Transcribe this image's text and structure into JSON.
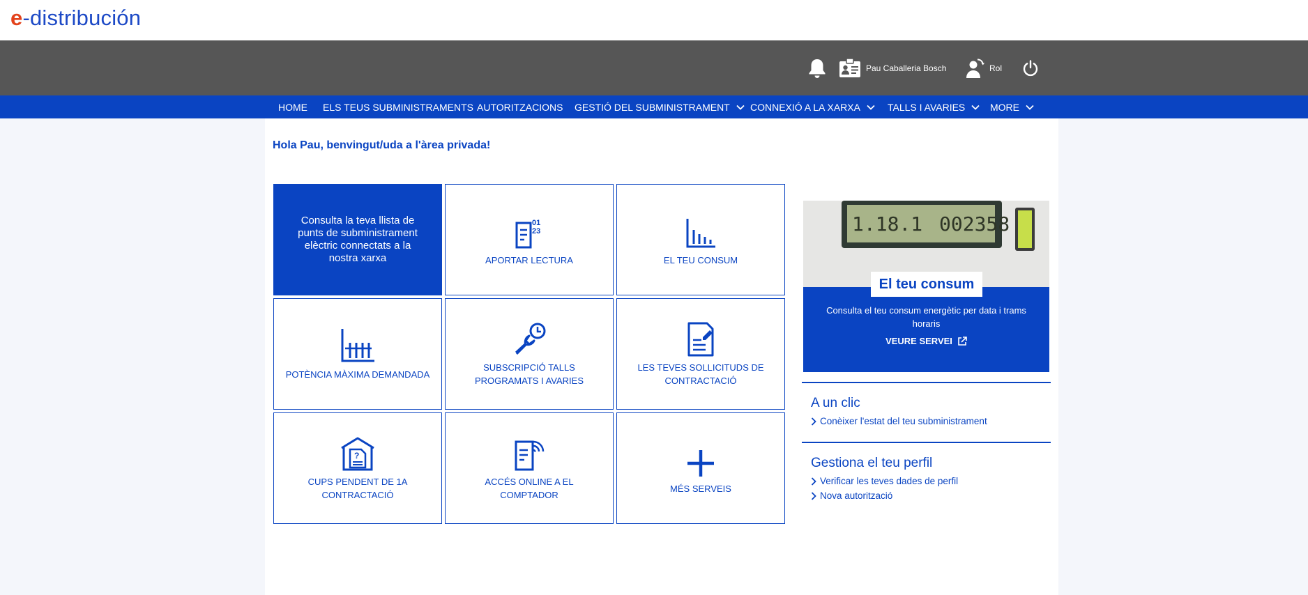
{
  "header": {
    "logo_e": "e",
    "logo_rest": "-distribución"
  },
  "topbar": {
    "user_name": "Pau Caballeria Bosch",
    "role_label": "Rol"
  },
  "nav": {
    "items": [
      {
        "label": "HOME"
      },
      {
        "label": "ELS TEUS SUBMINISTRAMENTS"
      },
      {
        "label": "AUTORITZACIONS"
      },
      {
        "label": "GESTIÓ DEL SUBMINISTRAMENT"
      },
      {
        "label": "CONNEXIÓ A LA XARXA"
      },
      {
        "label": "TALLS I AVARIES"
      },
      {
        "label": "MORE"
      }
    ]
  },
  "main": {
    "greeting": "Hola Pau, benvingut/uda a l'àrea privada!",
    "featured_tile": "Consulta la teva llista de punts de subministrament elèctric connectats a la nostra xarxa",
    "tiles": [
      {
        "label": "APORTAR LECTURA",
        "icon": "meter-reading-icon"
      },
      {
        "label": "EL TEU CONSUM",
        "icon": "consumption-chart-icon"
      },
      {
        "label": "POTÈNCIA MÀXIMA DEMANDADA",
        "icon": "max-power-chart-icon"
      },
      {
        "label": "SUBSCRIPCIÓ TALLS PROGRAMATS I AVARIES",
        "icon": "wrench-clock-icon"
      },
      {
        "label": "LES TEVES SOLLICITUDS DE CONTRACTACIÓ",
        "icon": "document-edit-icon"
      },
      {
        "label": "CUPS PENDENT DE 1A CONTRACTACIÓ",
        "icon": "house-question-icon"
      },
      {
        "label": "ACCÉS ONLINE A EL COMPTADOR",
        "icon": "online-meter-icon"
      },
      {
        "label": "MÉS SERVEIS",
        "icon": "plus-icon"
      }
    ]
  },
  "promo": {
    "meter_display_left": "1.18.1",
    "meter_display_right": "002358",
    "title": "El teu consum",
    "description": "Consulta el teu consum energètic per data i trams horaris",
    "link_label": "VEURE SERVEI"
  },
  "sidebar": {
    "quick": {
      "title": "A un clic",
      "links": [
        "Conèixer l'estat del teu subministrament"
      ]
    },
    "profile": {
      "title": "Gestiona el teu perfil",
      "links": [
        "Verificar les teves dades de perfil",
        "Nova autorització"
      ]
    }
  }
}
